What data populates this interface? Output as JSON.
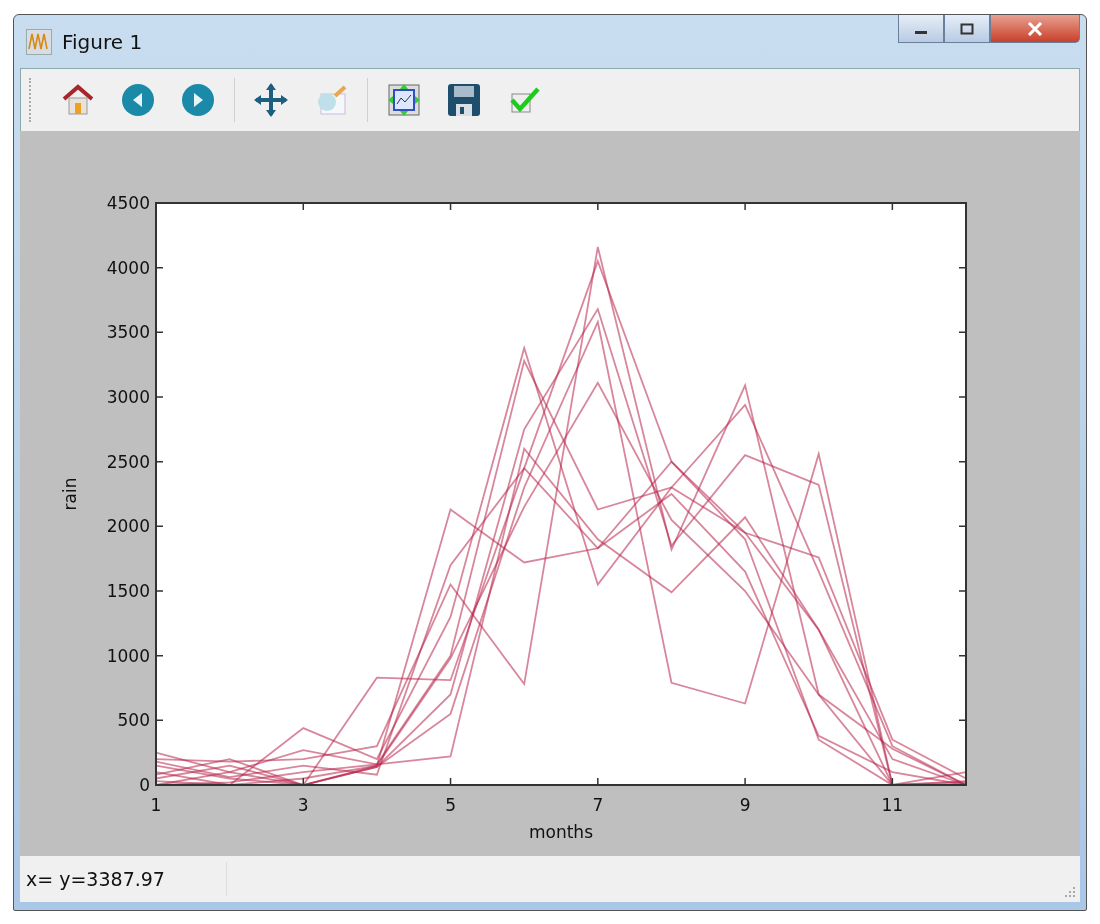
{
  "window": {
    "title": "Figure 1"
  },
  "chart_data": {
    "type": "line",
    "xlabel": "months",
    "ylabel": "rain",
    "x": [
      1,
      2,
      3,
      4,
      5,
      6,
      7,
      8,
      9,
      10,
      11,
      12
    ],
    "xlim": [
      1,
      12
    ],
    "ylim": [
      0,
      4500
    ],
    "xticks": [
      1,
      3,
      5,
      7,
      9,
      11
    ],
    "yticks": [
      0,
      500,
      1000,
      1500,
      2000,
      2500,
      3000,
      3500,
      4000,
      4500
    ],
    "series": [
      {
        "color": "#b8234a",
        "values": [
          250,
          100,
          0,
          150,
          2130,
          1720,
          1830,
          2500,
          1950,
          1200,
          0,
          0
        ]
      },
      {
        "color": "#b8234a",
        "values": [
          200,
          180,
          200,
          300,
          1550,
          780,
          4160,
          1820,
          3090,
          700,
          0,
          20
        ]
      },
      {
        "color": "#b8234a",
        "values": [
          100,
          0,
          440,
          200,
          1300,
          3380,
          1550,
          2300,
          2940,
          1650,
          300,
          0
        ]
      },
      {
        "color": "#b8234a",
        "values": [
          50,
          150,
          0,
          830,
          810,
          2450,
          4050,
          2500,
          1900,
          350,
          0,
          0
        ]
      },
      {
        "color": "#b8234a",
        "values": [
          0,
          100,
          270,
          160,
          1000,
          3280,
          2130,
          2300,
          1950,
          1760,
          350,
          50
        ]
      },
      {
        "color": "#b8234a",
        "values": [
          150,
          50,
          0,
          140,
          700,
          2750,
          3680,
          1850,
          2550,
          2320,
          0,
          100
        ]
      },
      {
        "color": "#b8234a",
        "values": [
          0,
          20,
          100,
          160,
          220,
          2600,
          1900,
          1490,
          2070,
          1200,
          200,
          0
        ]
      },
      {
        "color": "#b8234a",
        "values": [
          80,
          200,
          0,
          140,
          550,
          2300,
          3580,
          790,
          630,
          2560,
          0,
          30
        ]
      },
      {
        "color": "#b8234a",
        "values": [
          30,
          0,
          50,
          150,
          980,
          2150,
          3110,
          2050,
          1500,
          700,
          280,
          0
        ]
      },
      {
        "color": "#b8234a",
        "values": [
          180,
          60,
          150,
          80,
          1700,
          2450,
          1830,
          2250,
          1650,
          380,
          100,
          0
        ]
      }
    ]
  },
  "status_bar": {
    "text": "x= y=3387.97"
  }
}
